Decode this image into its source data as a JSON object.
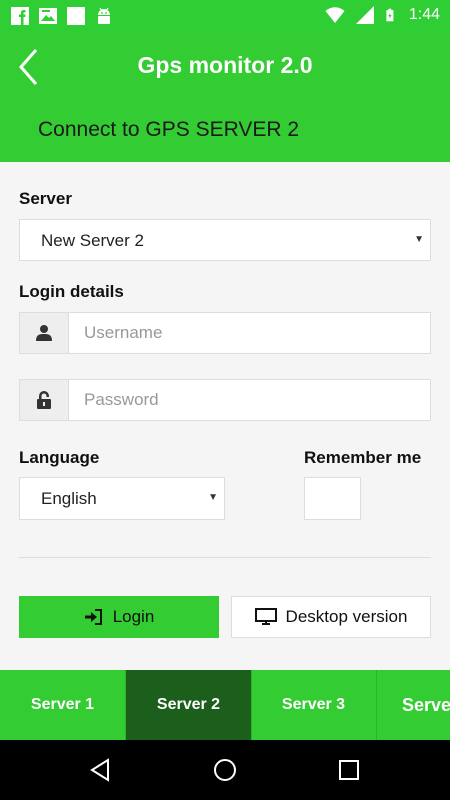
{
  "status_bar": {
    "time": "1:44",
    "left_icons": [
      "facebook-icon",
      "image-icon",
      "square-notification-icon",
      "android-icon"
    ],
    "right_icons": [
      "wifi-icon",
      "cell-signal-icon",
      "battery-charging-icon"
    ]
  },
  "app_bar": {
    "title": "Gps monitor 2.0",
    "subtitle": "Connect to GPS SERVER 2",
    "back_icon": "chevron-left-icon"
  },
  "form": {
    "server_label": "Server",
    "server_value": "New Server 2",
    "login_details_label": "Login details",
    "username_placeholder": "Username",
    "username_value": "",
    "password_placeholder": "Password",
    "password_value": "",
    "language_label": "Language",
    "language_value": "English",
    "remember_label": "Remember me",
    "remember_checked": false
  },
  "buttons": {
    "login_label": "Login",
    "desktop_label": "Desktop version"
  },
  "tabs": [
    {
      "label": "Server 1",
      "active": false
    },
    {
      "label": "Server 2",
      "active": true
    },
    {
      "label": "Server 3",
      "active": false
    },
    {
      "label": "Server",
      "active": false
    }
  ],
  "nav_bar": {
    "icons": [
      "back-triangle-icon",
      "home-circle-icon",
      "recents-square-icon"
    ]
  },
  "colors": {
    "accent": "#33cc33",
    "tab_active": "#1c5e1c",
    "status_bar": "#2fce35"
  }
}
